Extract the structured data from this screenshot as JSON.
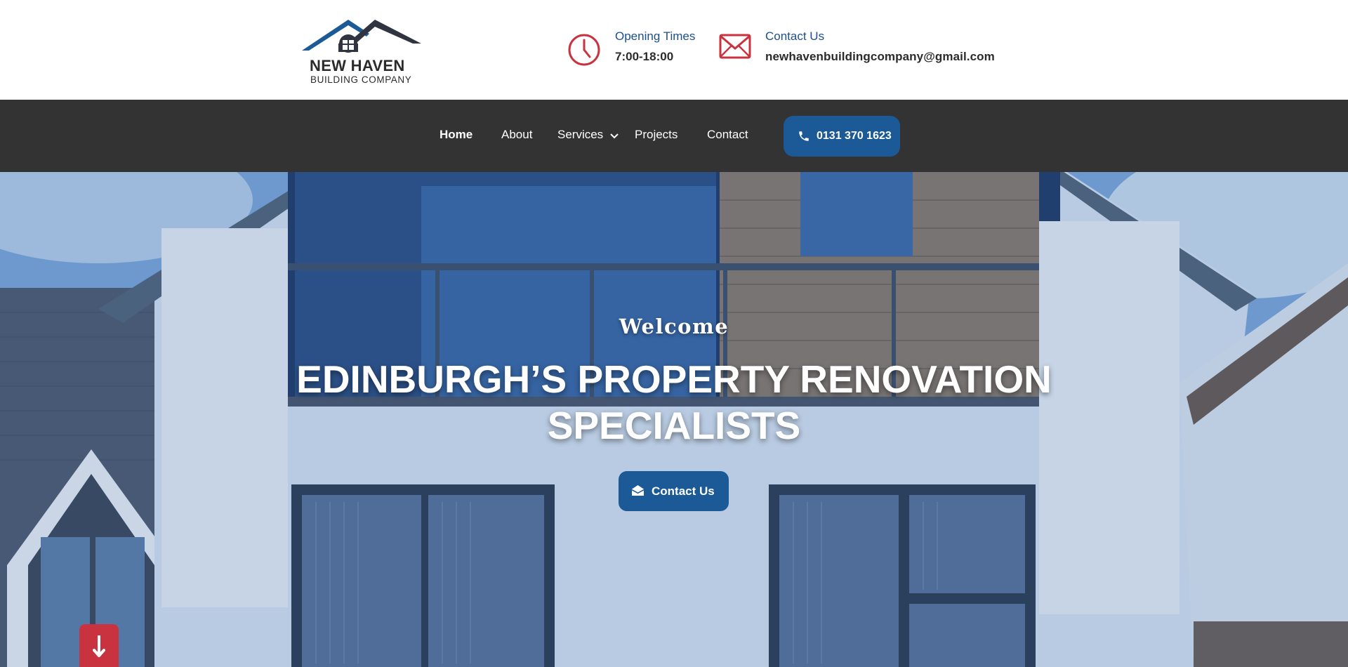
{
  "brand": {
    "name": "NEW HAVEN",
    "tagline": "BUILDING  COMPANY"
  },
  "header": {
    "hours_label": "Opening Times",
    "hours_value": "7:00-18:00",
    "contact_label": "Contact Us",
    "contact_value": "newhavenbuildingcompany@gmail.com"
  },
  "nav": {
    "home": "Home",
    "about": "About",
    "services": "Services",
    "projects": "Projects",
    "contact": "Contact",
    "phone": "0131 370 1623"
  },
  "hero": {
    "kicker": "Welcome",
    "headline_line1": "EDINBURGH’S PROPERTY RENOVATION",
    "headline_line2": "SPECIALISTS",
    "cta_label": "Contact Us"
  },
  "icons": {
    "hours": "clock-icon",
    "contact": "envelope-icon",
    "phone": "phone-icon",
    "cta": "envelope-open-icon",
    "scroll": "arrow-down-icon",
    "dropdown": "chevron-down-icon"
  },
  "colors": {
    "brand_blue": "#1b5a96",
    "nav_bg": "#333333",
    "accent_red": "#c9333f",
    "label_blue": "#1d4f8a"
  }
}
